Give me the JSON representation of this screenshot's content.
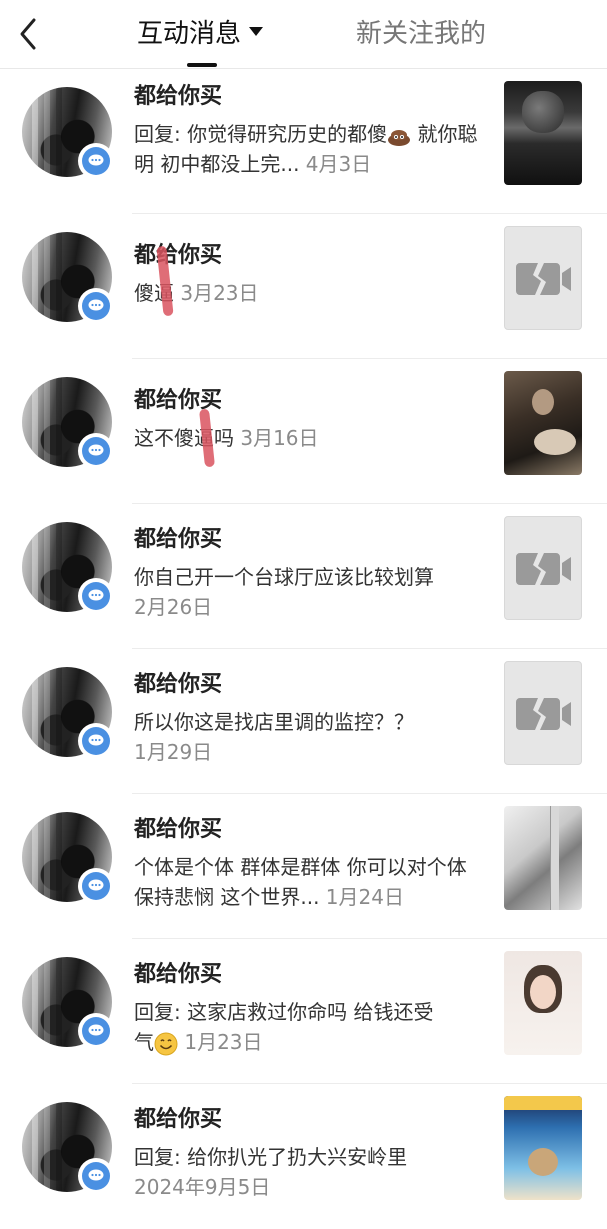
{
  "header": {
    "tab_active": "互动消息",
    "tab_inactive": "新关注我的"
  },
  "messages": [
    {
      "name": "都给你买",
      "text": "回复: 你觉得研究历史的都傻",
      "text2": "就你聪明 初中都没上完...",
      "date": "4月3日"
    },
    {
      "name": "都给你买",
      "text": "傻逼",
      "date": "3月23日"
    },
    {
      "name": "都给你买",
      "text": "这不傻逼吗",
      "date": "3月16日"
    },
    {
      "name": "都给你买",
      "text": "你自己开一个台球厅应该比较划算",
      "date": "2月26日"
    },
    {
      "name": "都给你买",
      "text": "所以你这是找店里调的监控？？",
      "date": "1月29日"
    },
    {
      "name": "都给你买",
      "text": "个体是个体 群体是群体 你可以对个体保持悲悯 这个世界...",
      "date": "1月24日"
    },
    {
      "name": "都给你买",
      "text": "回复: 这家店救过你命吗 给钱还受",
      "text2": "气",
      "date": "1月23日"
    },
    {
      "name": "都给你买",
      "text": "回复: 给你扒光了扔大兴安岭里",
      "date": "2024年9月5日"
    }
  ]
}
